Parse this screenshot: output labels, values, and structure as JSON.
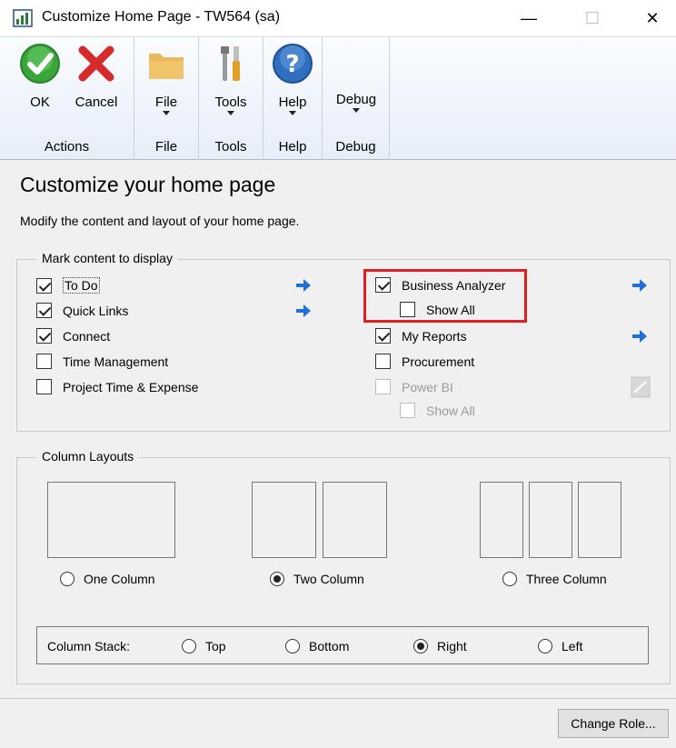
{
  "window": {
    "title": "Customize Home Page  -  TW564 (sa)",
    "minimize": "—",
    "maximize": "☐",
    "close": "✕"
  },
  "ribbon": {
    "groups": [
      {
        "label": "Actions",
        "buttons": [
          {
            "label": "OK",
            "icon": "ok-check-icon"
          },
          {
            "label": "Cancel",
            "icon": "cancel-x-icon"
          }
        ]
      },
      {
        "label": "File",
        "buttons": [
          {
            "label": "File",
            "icon": "folder-icon"
          }
        ]
      },
      {
        "label": "Tools",
        "buttons": [
          {
            "label": "Tools",
            "icon": "tools-icon"
          }
        ]
      },
      {
        "label": "Help",
        "buttons": [
          {
            "label": "Help",
            "icon": "help-icon"
          }
        ]
      },
      {
        "label": "Debug",
        "buttons": [
          {
            "label": "Debug",
            "icon": ""
          }
        ]
      }
    ]
  },
  "page": {
    "heading": "Customize your home page",
    "subheading": "Modify the content and layout of your home page."
  },
  "content": {
    "legend": "Mark content to display",
    "left_items": [
      {
        "label": "To Do",
        "checked": true
      },
      {
        "label": "Quick Links",
        "checked": true
      },
      {
        "label": "Connect",
        "checked": true
      },
      {
        "label": "Time Management",
        "checked": false
      },
      {
        "label": "Project Time & Expense",
        "checked": false
      }
    ],
    "right_items": [
      {
        "label": "Business Analyzer",
        "checked": true
      },
      {
        "label": "Show All",
        "checked": false
      },
      {
        "label": "My Reports",
        "checked": true
      },
      {
        "label": "Procurement",
        "checked": false
      },
      {
        "label": "Power BI",
        "checked": false,
        "disabled": true
      },
      {
        "label": "Show All",
        "checked": false,
        "disabled": true
      }
    ]
  },
  "layouts": {
    "legend": "Column Layouts",
    "options": [
      {
        "label": "One Column",
        "selected": false
      },
      {
        "label": "Two Column",
        "selected": true
      },
      {
        "label": "Three Column",
        "selected": false
      }
    ],
    "stack": {
      "label": "Column Stack:",
      "options": [
        {
          "label": "Top",
          "selected": false
        },
        {
          "label": "Bottom",
          "selected": false
        },
        {
          "label": "Right",
          "selected": true
        },
        {
          "label": "Left",
          "selected": false
        }
      ]
    }
  },
  "footer": {
    "change_role": "Change Role..."
  },
  "colors": {
    "highlight": "#e02020",
    "arrow_blue": "#1f6fd6",
    "ok_green": "#3aa63a",
    "cancel_red": "#d72a2a"
  }
}
